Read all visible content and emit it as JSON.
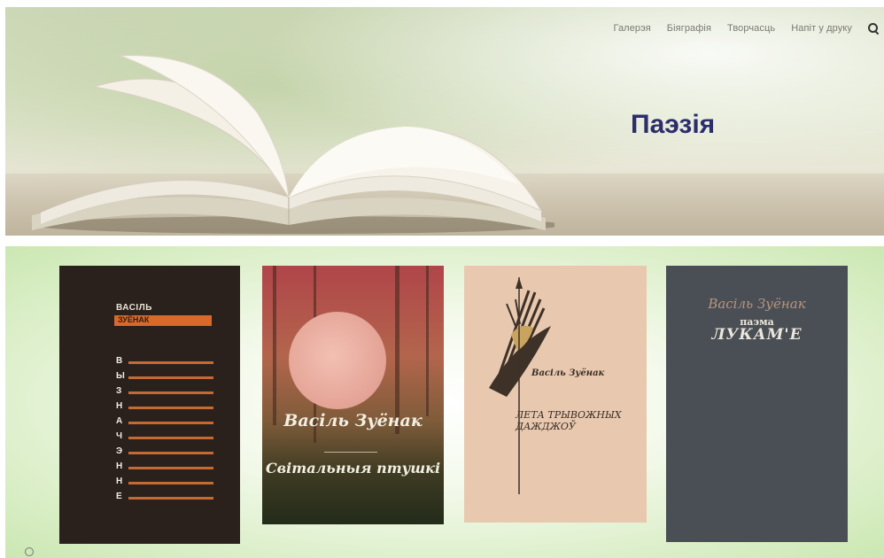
{
  "nav": {
    "items": [
      "Галерэя",
      "Біяграфія",
      "Творчасць",
      "Напіт у друку"
    ],
    "search_icon": "search-icon"
  },
  "hero": {
    "title": "Паэзія",
    "image": "open-book-on-table"
  },
  "gallery": {
    "covers": [
      {
        "author": "ВАСІЛЬ",
        "author_name": "ЗУЁНАК",
        "title_letters": [
          "В",
          "Ы",
          "З",
          "Н",
          "А",
          "Ч",
          "Э",
          "Н",
          "Н",
          "Е"
        ],
        "colors": {
          "bg": "#2a211c",
          "accent": "#d9692b"
        }
      },
      {
        "author": "Васіль Зуёнак",
        "title": "Світальныя птушкі",
        "colors": {
          "bg": "#b0454a",
          "moon": "#f2c0b2"
        }
      },
      {
        "author": "Васіль Зуёнак",
        "title": "ЛЕТА ТРЫВОЖНЫХ ДАЖДЖОЎ",
        "colors": {
          "bg": "#e8c9b0"
        }
      },
      {
        "author": "Васіль Зуёнак",
        "title_small": "паэма",
        "title": "ЛУКАМ'Е",
        "colors": {
          "bg": "#4a4f55"
        }
      }
    ]
  }
}
